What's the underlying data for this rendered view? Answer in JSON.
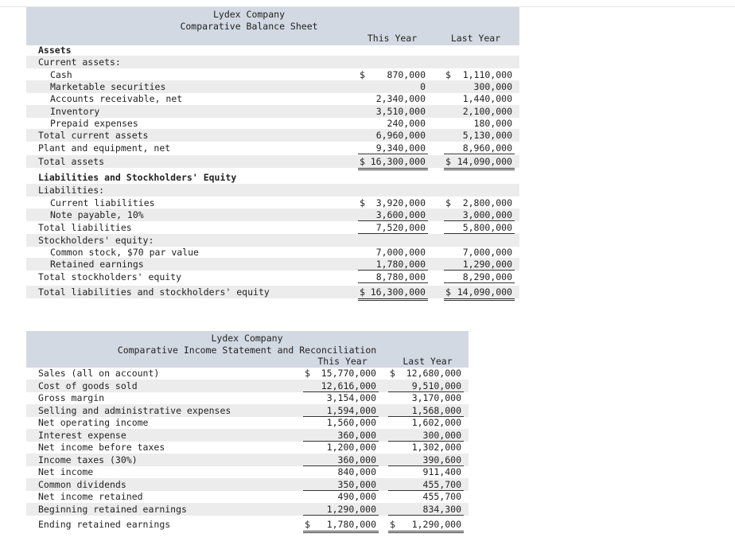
{
  "balance_sheet": {
    "company": "Lydex Company",
    "title": "Comparative Balance Sheet",
    "col_this": "This Year",
    "col_last": "Last Year",
    "rows": [
      {
        "label": "Assets",
        "indent": 0,
        "bold": true,
        "this": "",
        "last": "",
        "cur": false,
        "line": "",
        "shade": false
      },
      {
        "label": "Current assets:",
        "indent": 0,
        "bold": false,
        "this": "",
        "last": "",
        "cur": false,
        "line": "",
        "shade": true
      },
      {
        "label": "Cash",
        "indent": 1,
        "bold": false,
        "this": "870,000",
        "last": "1,110,000",
        "cur": true,
        "line": "",
        "shade": false
      },
      {
        "label": "Marketable securities",
        "indent": 1,
        "bold": false,
        "this": "0",
        "last": "300,000",
        "cur": false,
        "line": "",
        "shade": true
      },
      {
        "label": "Accounts receivable, net",
        "indent": 1,
        "bold": false,
        "this": "2,340,000",
        "last": "1,440,000",
        "cur": false,
        "line": "",
        "shade": false
      },
      {
        "label": "Inventory",
        "indent": 1,
        "bold": false,
        "this": "3,510,000",
        "last": "2,100,000",
        "cur": false,
        "line": "",
        "shade": true
      },
      {
        "label": "Prepaid expenses",
        "indent": 1,
        "bold": false,
        "this": "240,000",
        "last": "180,000",
        "cur": false,
        "line": "single",
        "shade": false
      },
      {
        "label": "Total current assets",
        "indent": 0,
        "bold": false,
        "this": "6,960,000",
        "last": "5,130,000",
        "cur": false,
        "line": "",
        "shade": true
      },
      {
        "label": "Plant and equipment, net",
        "indent": 0,
        "bold": false,
        "this": "9,340,000",
        "last": "8,960,000",
        "cur": false,
        "line": "single",
        "shade": false
      },
      {
        "label": "Total assets",
        "indent": 0,
        "bold": false,
        "this": "16,300,000",
        "last": "14,090,000",
        "cur": true,
        "line": "double",
        "shade": true
      },
      {
        "label": "Liabilities and Stockholders' Equity",
        "indent": 0,
        "bold": true,
        "this": "",
        "last": "",
        "cur": false,
        "line": "",
        "shade": false
      },
      {
        "label": "Liabilities:",
        "indent": 0,
        "bold": false,
        "this": "",
        "last": "",
        "cur": false,
        "line": "",
        "shade": true
      },
      {
        "label": "Current liabilities",
        "indent": 1,
        "bold": false,
        "this": "3,920,000",
        "last": "2,800,000",
        "cur": true,
        "line": "",
        "shade": false
      },
      {
        "label": "Note payable, 10%",
        "indent": 1,
        "bold": false,
        "this": "3,600,000",
        "last": "3,000,000",
        "cur": false,
        "line": "single",
        "shade": true
      },
      {
        "label": "Total liabilities",
        "indent": 0,
        "bold": false,
        "this": "7,520,000",
        "last": "5,800,000",
        "cur": false,
        "line": "single",
        "shade": false
      },
      {
        "label": "Stockholders' equity:",
        "indent": 0,
        "bold": false,
        "this": "",
        "last": "",
        "cur": false,
        "line": "",
        "shade": true
      },
      {
        "label": "Common stock, $70 par value",
        "indent": 1,
        "bold": false,
        "this": "7,000,000",
        "last": "7,000,000",
        "cur": false,
        "line": "",
        "shade": false
      },
      {
        "label": "Retained earnings",
        "indent": 1,
        "bold": false,
        "this": "1,780,000",
        "last": "1,290,000",
        "cur": false,
        "line": "single",
        "shade": true
      },
      {
        "label": "Total stockholders' equity",
        "indent": 0,
        "bold": false,
        "this": "8,780,000",
        "last": "8,290,000",
        "cur": false,
        "line": "single",
        "shade": false
      },
      {
        "label": "Total liabilities and stockholders' equity",
        "indent": 0,
        "bold": false,
        "this": "16,300,000",
        "last": "14,090,000",
        "cur": true,
        "line": "double",
        "shade": true
      }
    ]
  },
  "income_statement": {
    "company": "Lydex Company",
    "title": "Comparative Income Statement and Reconciliation",
    "col_this": "This Year",
    "col_last": "Last Year",
    "rows": [
      {
        "label": "Sales (all on account)",
        "this": "15,770,000",
        "last": "12,680,000",
        "cur": true,
        "line": "",
        "shade": false
      },
      {
        "label": "Cost of goods sold",
        "this": "12,616,000",
        "last": "9,510,000",
        "cur": false,
        "line": "single",
        "shade": true
      },
      {
        "label": "Gross margin",
        "this": "3,154,000",
        "last": "3,170,000",
        "cur": false,
        "line": "",
        "shade": false
      },
      {
        "label": "Selling and administrative expenses",
        "this": "1,594,000",
        "last": "1,568,000",
        "cur": false,
        "line": "single",
        "shade": true
      },
      {
        "label": "Net operating income",
        "this": "1,560,000",
        "last": "1,602,000",
        "cur": false,
        "line": "",
        "shade": false
      },
      {
        "label": "Interest expense",
        "this": "360,000",
        "last": "300,000",
        "cur": false,
        "line": "single",
        "shade": true
      },
      {
        "label": "Net income before taxes",
        "this": "1,200,000",
        "last": "1,302,000",
        "cur": false,
        "line": "",
        "shade": false
      },
      {
        "label": "Income taxes (30%)",
        "this": "360,000",
        "last": "390,600",
        "cur": false,
        "line": "single",
        "shade": true
      },
      {
        "label": "Net income",
        "this": "840,000",
        "last": "911,400",
        "cur": false,
        "line": "",
        "shade": false
      },
      {
        "label": "Common dividends",
        "this": "350,000",
        "last": "455,700",
        "cur": false,
        "line": "single",
        "shade": true
      },
      {
        "label": "Net income retained",
        "this": "490,000",
        "last": "455,700",
        "cur": false,
        "line": "",
        "shade": false
      },
      {
        "label": "Beginning retained earnings",
        "this": "1,290,000",
        "last": "834,300",
        "cur": false,
        "line": "single",
        "shade": true
      },
      {
        "label": "Ending retained earnings",
        "this": "1,780,000",
        "last": "1,290,000",
        "cur": true,
        "line": "double",
        "shade": false
      }
    ]
  }
}
